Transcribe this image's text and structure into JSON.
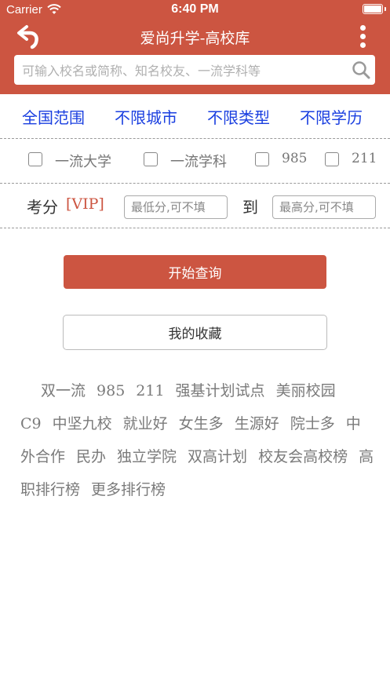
{
  "status_bar": {
    "carrier": "Carrier",
    "time": "6:40 PM"
  },
  "header": {
    "title": "爱尚升学-高校库"
  },
  "search": {
    "placeholder": "可输入校名或简称、知名校友、一流学科等"
  },
  "filters": [
    "全国范围",
    "不限城市",
    "不限类型",
    "不限学历"
  ],
  "checkboxes": [
    "一流大学",
    "一流学科",
    "985",
    "211"
  ],
  "score": {
    "label": "考分",
    "vip": "[VIP]",
    "min_placeholder": "最低分,可不填",
    "to": "到",
    "max_placeholder": "最高分,可不填"
  },
  "buttons": {
    "query": "开始查询",
    "favorites": "我的收藏"
  },
  "tags": [
    "双一流",
    "985",
    "211",
    "强基计划试点",
    "美丽校园",
    "C9",
    "中坚九校",
    "就业好",
    "女生多",
    "生源好",
    "院士多",
    "中外合作",
    "民办",
    "独立学院",
    "双高计划",
    "校友会高校榜",
    "高职排行榜",
    "更多排行榜"
  ],
  "colors": {
    "header": "#cc5541",
    "filter_text": "#1a3fe0",
    "vip": "#cc5541"
  }
}
